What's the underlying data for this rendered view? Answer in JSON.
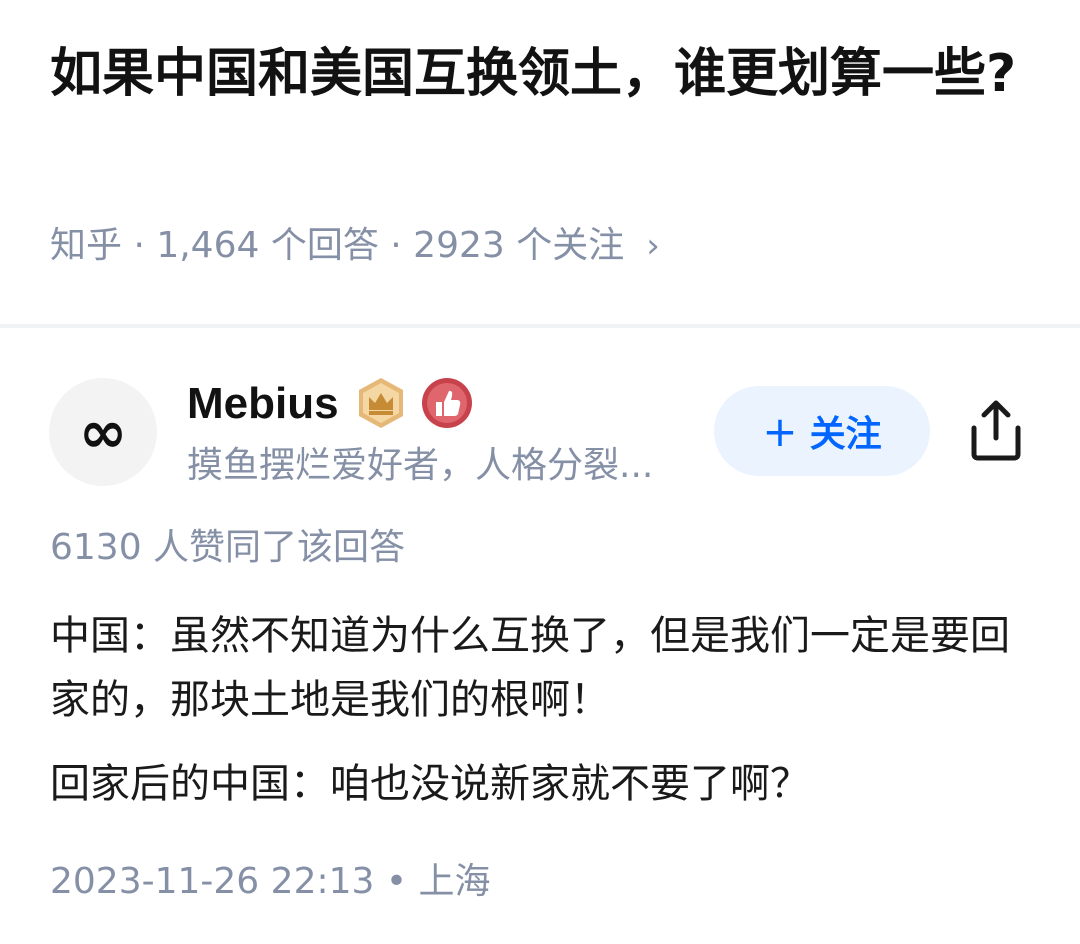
{
  "question": {
    "title": "如果中国和美国互换领土，谁更划算一些?",
    "meta": "知乎 · 1,464 个回答 · 2923 个关注",
    "chevron": "›"
  },
  "author": {
    "avatar_symbol": "∞",
    "name": "Mebius",
    "bio": "摸鱼摆烂爱好者，人格分裂...",
    "badges": [
      "crown-badge-icon",
      "thumbs-up-badge-icon"
    ]
  },
  "actions": {
    "follow_plus": "+",
    "follow_label": "关注",
    "share_icon": "share-icon"
  },
  "answer": {
    "votes": "6130 人赞同了该回答",
    "paragraphs": [
      "中国：虽然不知道为什么互换了，但是我们一定是要回家的，那块土地是我们的根啊！",
      "回家后的中国：咱也没说新家就不要了啊？"
    ],
    "timestamp": "2023-11-26 22:13 • 上海"
  },
  "colors": {
    "accent": "#0066ff",
    "accent_bg": "#ebf3ff",
    "muted": "#8590a6",
    "crown_gold": "#d9a55a",
    "like_red": "#c8424c"
  }
}
